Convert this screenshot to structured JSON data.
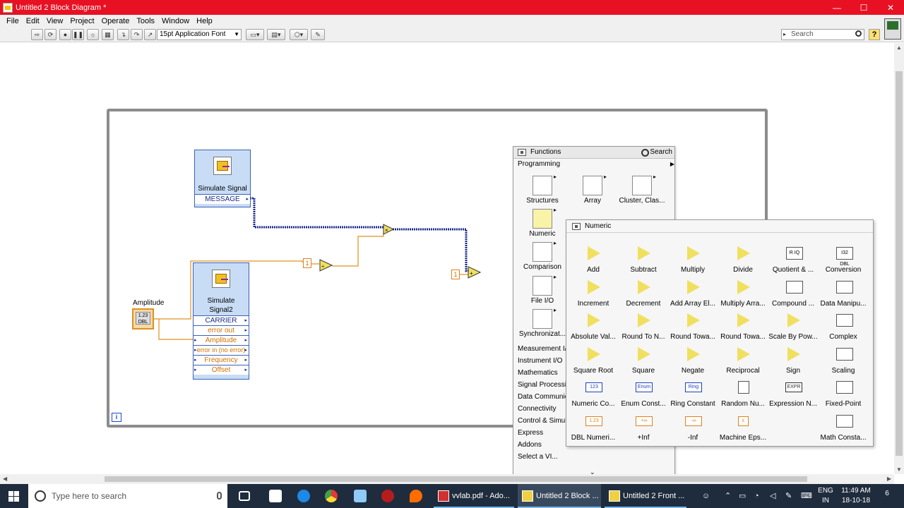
{
  "window": {
    "title": "Untitled 2 Block Diagram *",
    "minimize": "—",
    "maximize": "☐",
    "close": "✕"
  },
  "menu": [
    "File",
    "Edit",
    "View",
    "Project",
    "Operate",
    "Tools",
    "Window",
    "Help"
  ],
  "toolbar": {
    "font": "15pt Application Font",
    "search_placeholder": "Search",
    "help": "?"
  },
  "diagram": {
    "sim1": {
      "name": "Simulate Signal",
      "terminal": "MESSAGE"
    },
    "sim2": {
      "name_line1": "Simulate",
      "name_line2": "Signal2",
      "terminals": [
        "CARRIER",
        "error out",
        "Amplitude",
        "error in (no error)",
        "Frequency",
        "Offset"
      ]
    },
    "control": {
      "label": "Amplitude",
      "value": "1.23",
      "type": "DBL"
    },
    "const1": "1",
    "const2": "1",
    "loop_info": "i"
  },
  "functions_palette": {
    "title": "Functions",
    "search": "Search",
    "category": "Programming",
    "items": [
      "Structures",
      "Array",
      "Cluster, Clas...",
      "Numeric",
      "Comparison",
      "File I/O",
      "Synchronizat..."
    ],
    "subcategories": [
      "Measurement I/O",
      "Instrument I/O",
      "Mathematics",
      "Signal Processing",
      "Data Communication",
      "Connectivity",
      "Control & Simulation",
      "Express",
      "Addons",
      "Select a VI..."
    ]
  },
  "numeric_palette": {
    "title": "Numeric",
    "items": [
      "Add",
      "Subtract",
      "Multiply",
      "Divide",
      "Quotient & ...",
      "Conversion",
      "Increment",
      "Decrement",
      "Add Array El...",
      "Multiply Arra...",
      "Compound ...",
      "Data Manipu...",
      "Absolute Val...",
      "Round To N...",
      "Round Towa...",
      "Round Towa...",
      "Scale By Pow...",
      "Complex",
      "Square Root",
      "Square",
      "Negate",
      "Reciprocal",
      "Sign",
      "Scaling",
      "Numeric Co...",
      "Enum Const...",
      "Ring Constant",
      "Random Nu...",
      "Expression N...",
      "Fixed-Point",
      "DBL Numeri...",
      "+Inf",
      "-Inf",
      "Machine Eps...",
      "Math Consta..."
    ],
    "icon_texts": {
      "quotient": "R IQ",
      "conversion": "I32 DBL",
      "numeric_const": "123",
      "enum_const": "Enum",
      "ring_const": "Ring",
      "expr": "EXPR",
      "dbl_const": "1.23",
      "pinf": "+∞",
      "ninf": "-∞",
      "eps": "ε"
    }
  },
  "taskbar": {
    "search_placeholder": "Type here to search",
    "tasks": [
      "vvlab.pdf - Ado...",
      "Untitled 2 Block ...",
      "Untitled 2 Front ..."
    ],
    "lang_top": "ENG",
    "lang_bottom": "IN",
    "time": "11:49 AM",
    "date": "18-10-18",
    "notifications": "6"
  }
}
